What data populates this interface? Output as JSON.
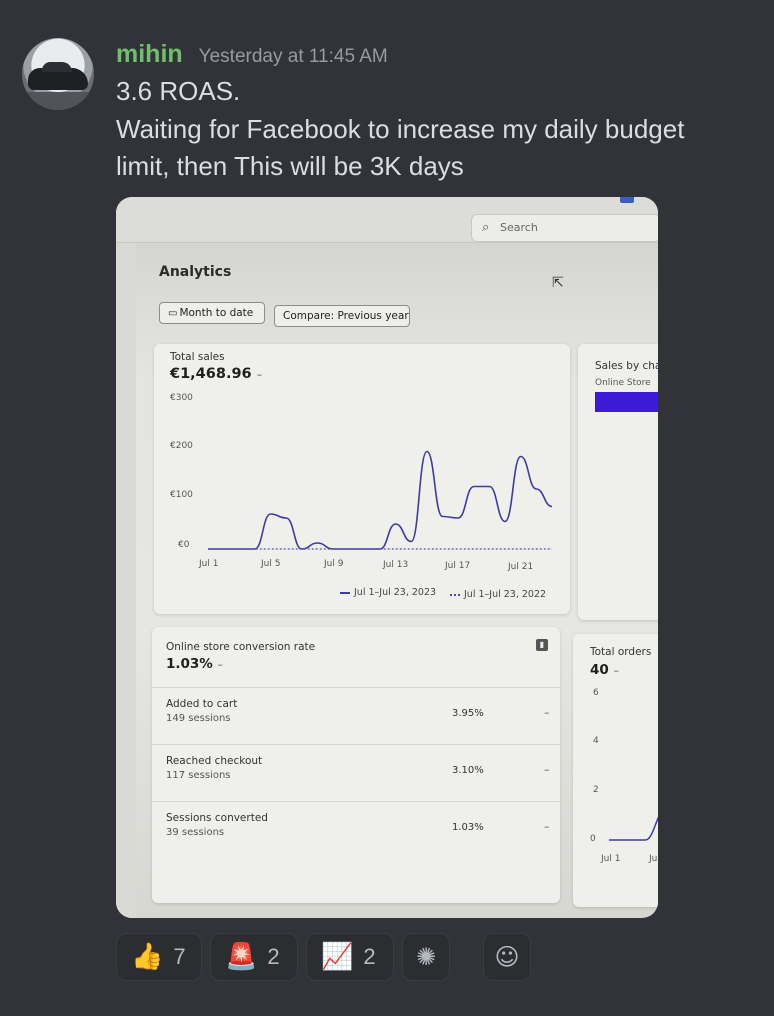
{
  "message": {
    "username": "mihin",
    "timestamp": "Yesterday at 11:45 AM",
    "lines": [
      "3.6 ROAS.",
      "Waiting for Facebook to increase my daily budget",
      "limit, then This will be 3K days"
    ]
  },
  "photo": {
    "search_placeholder": "Search",
    "page_title": "Analytics",
    "date_button": "Month to date",
    "compare_button": "Compare: Previous year",
    "total_sales": {
      "title": "Total sales",
      "value": "€1,468.96",
      "change": "–",
      "yticks": [
        "€300",
        "€200",
        "€100",
        "€0"
      ],
      "xticks": [
        "Jul 1",
        "Jul 5",
        "Jul 9",
        "Jul 13",
        "Jul 17",
        "Jul 21"
      ],
      "legend": [
        "Jul 1–Jul 23, 2023",
        "Jul 1–Jul 23, 2022"
      ]
    },
    "sales_by_channel": {
      "title": "Sales by char",
      "subtitle": "Online Store"
    },
    "conversion": {
      "title": "Online store conversion rate",
      "value": "1.03%",
      "change": "–",
      "rows": [
        {
          "label": "Added to cart",
          "sessions": "149 sessions",
          "pct": "3.95%",
          "change": "–"
        },
        {
          "label": "Reached checkout",
          "sessions": "117 sessions",
          "pct": "3.10%",
          "change": "–"
        },
        {
          "label": "Sessions converted",
          "sessions": "39 sessions",
          "pct": "1.03%",
          "change": "–"
        }
      ]
    },
    "total_orders": {
      "title": "Total orders",
      "value": "40",
      "change": "–",
      "yticks": [
        "6",
        "4",
        "2",
        "0"
      ],
      "xticks": [
        "Jul 1",
        "Ju"
      ]
    }
  },
  "chart_data": {
    "type": "line",
    "title": "Total sales",
    "x": [
      "Jul 1",
      "Jul 2",
      "Jul 3",
      "Jul 4",
      "Jul 5",
      "Jul 6",
      "Jul 7",
      "Jul 8",
      "Jul 9",
      "Jul 10",
      "Jul 11",
      "Jul 12",
      "Jul 13",
      "Jul 14",
      "Jul 15",
      "Jul 16",
      "Jul 17",
      "Jul 18",
      "Jul 19",
      "Jul 20",
      "Jul 21",
      "Jul 22",
      "Jul 23"
    ],
    "series": [
      {
        "name": "Jul 1–Jul 23, 2023",
        "values": [
          0,
          0,
          0,
          0,
          70,
          62,
          0,
          12,
          0,
          0,
          0,
          0,
          50,
          15,
          195,
          65,
          62,
          125,
          125,
          55,
          185,
          120,
          85
        ]
      },
      {
        "name": "Jul 1–Jul 23, 2022",
        "values": [
          0,
          0,
          0,
          0,
          0,
          0,
          0,
          0,
          0,
          0,
          0,
          0,
          0,
          0,
          0,
          0,
          0,
          0,
          0,
          0,
          0,
          0,
          0
        ]
      }
    ],
    "ylim": [
      0,
      300
    ],
    "yticks": [
      "€300",
      "€200",
      "€100",
      "€0"
    ]
  },
  "reactions": [
    {
      "emoji": "👍",
      "count": "7"
    },
    {
      "emoji": "🚨",
      "count": "2"
    },
    {
      "emoji": "📈",
      "count": "2"
    }
  ],
  "colors": {
    "username": "#6fbf6b",
    "series_current": "#3d3aa8",
    "background": "#313338"
  }
}
